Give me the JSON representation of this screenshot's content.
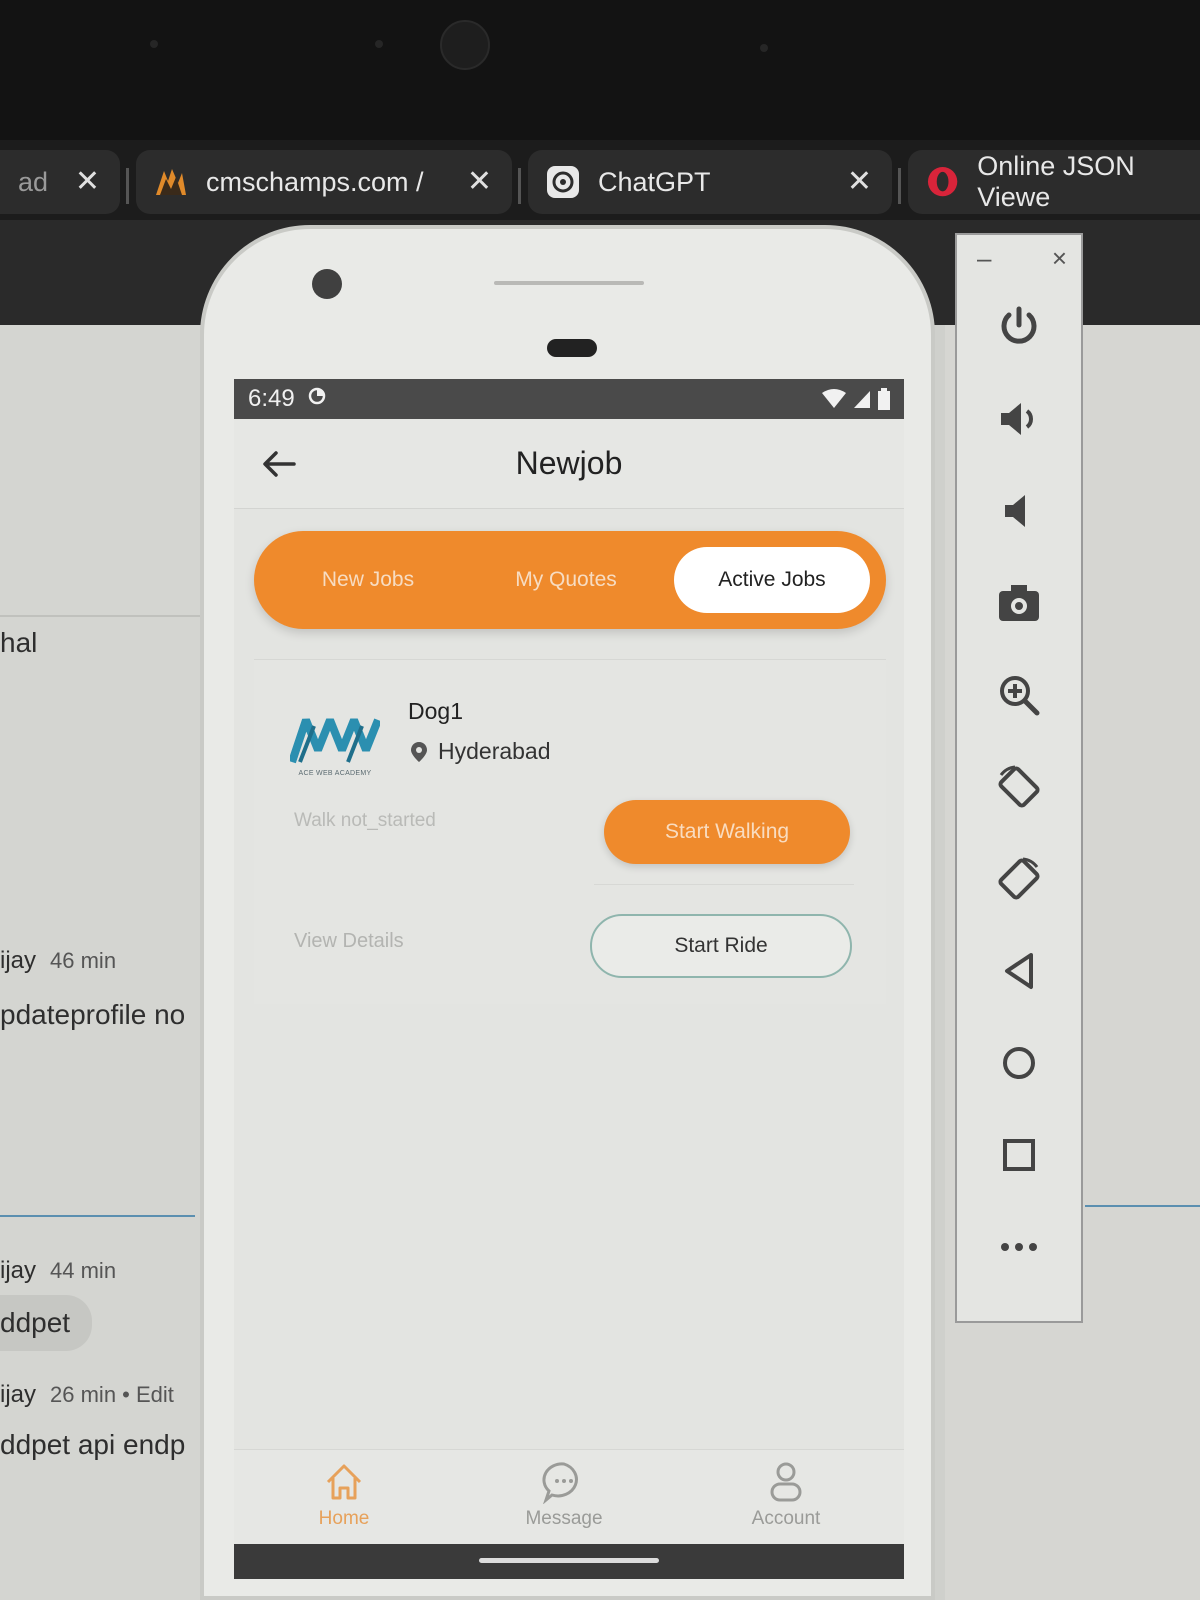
{
  "browser": {
    "tabs": [
      {
        "label": "ad",
        "icon": "page-icon"
      },
      {
        "label": "cmschamps.com / ",
        "icon": "cmschamps-logo-icon"
      },
      {
        "label": "ChatGPT",
        "icon": "chatgpt-logo-icon"
      },
      {
        "label": "Online JSON Viewe",
        "icon": "opera-icon"
      }
    ]
  },
  "background_chat": {
    "heading": "hal",
    "messages": [
      {
        "author": "ijay",
        "time": "46 min",
        "text": "pdateprofile no"
      },
      {
        "author": "ijay",
        "time": "44 min",
        "text": "ddpet"
      },
      {
        "author": "ijay",
        "time": "26 min • Edit",
        "text": "ddpet api endp"
      }
    ]
  },
  "emulator_toolbar": {
    "window_controls": [
      "–",
      "×"
    ],
    "buttons": [
      "power-icon",
      "volume-up-icon",
      "volume-down-icon",
      "camera-icon",
      "zoom-in-icon",
      "rotate-left-icon",
      "rotate-right-icon",
      "back-triangle-icon",
      "home-circle-icon",
      "overview-square-icon",
      "more-dots-icon"
    ]
  },
  "status_bar": {
    "time": "6:49"
  },
  "app_bar": {
    "title": "Newjob"
  },
  "segments": {
    "items": [
      "New Jobs",
      "My Quotes",
      "Active Jobs"
    ],
    "active_index": 2
  },
  "job": {
    "logo_text": "ACE WEB ACADEMY",
    "pet_name": "Dog1",
    "location": "Hyderabad",
    "walk_status": "Walk not_started",
    "start_walking_label": "Start Walking",
    "view_details_label": "View Details",
    "start_ride_label": "Start Ride"
  },
  "bottom_nav": [
    {
      "label": "Home",
      "icon": "home-icon",
      "active": true
    },
    {
      "label": "Message",
      "icon": "message-icon",
      "active": false
    },
    {
      "label": "Account",
      "icon": "account-icon",
      "active": false
    }
  ],
  "colors": {
    "accent": "#ef8a2c",
    "outline": "#8fb5ad",
    "active_nav": "#e7a15a"
  }
}
